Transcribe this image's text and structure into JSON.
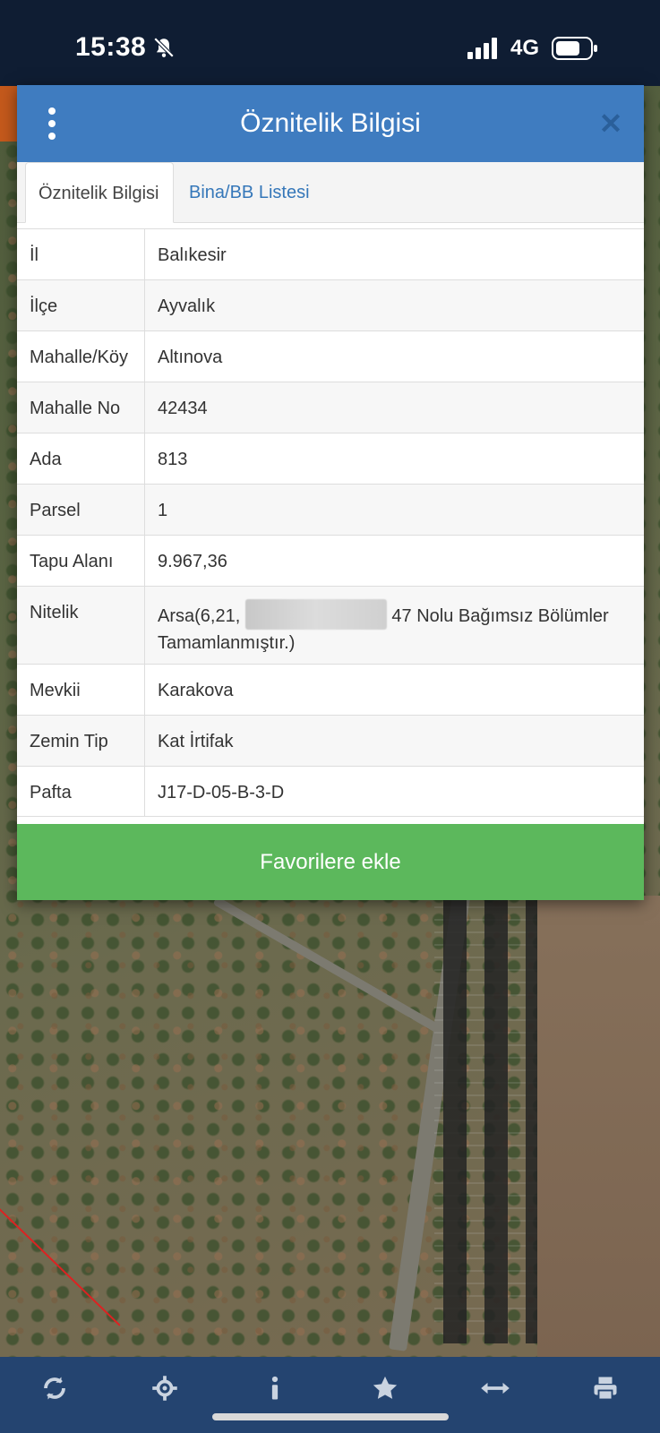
{
  "status_bar": {
    "time": "15:38",
    "network": "4G",
    "icons": [
      "bell-muted-icon",
      "signal-icon",
      "battery-icon"
    ]
  },
  "modal": {
    "title": "Öznitelik Bilgisi",
    "menu_icon": "more-vertical-icon",
    "close_icon": "close-icon",
    "close_glyph": "✕",
    "tabs": [
      {
        "label": "Öznitelik Bilgisi",
        "active": true
      },
      {
        "label": "Bina/BB Listesi",
        "active": false
      }
    ],
    "rows": [
      {
        "key": "İl",
        "value": "Balıkesir"
      },
      {
        "key": "İlçe",
        "value": "Ayvalık"
      },
      {
        "key": "Mahalle/Köy",
        "value": "Altınova"
      },
      {
        "key": "Mahalle No",
        "value": "42434"
      },
      {
        "key": "Ada",
        "value": "813"
      },
      {
        "key": "Parsel",
        "value": "1"
      },
      {
        "key": "Tapu Alanı",
        "value": "9.967,36"
      },
      {
        "key": "Nitelik",
        "value_prefix": "Arsa(6,21,",
        "value_suffix": "47 Nolu Bağımsız Bölümler Tamamlanmıştır.)"
      },
      {
        "key": "Mevkii",
        "value": "Karakova"
      },
      {
        "key": "Zemin Tip",
        "value": "Kat İrtifak"
      },
      {
        "key": "Pafta",
        "value": "J17-D-05-B-3-D"
      }
    ],
    "favorite_button": "Favorilere ekle"
  },
  "toolbar": {
    "items": [
      "refresh-icon",
      "locate-icon",
      "info-icon",
      "star-icon",
      "measure-icon",
      "print-icon"
    ]
  },
  "colors": {
    "header_blue": "#3f7cc0",
    "toolbar_blue": "#244470",
    "button_green": "#5cb85c",
    "status_bar": "#0f1d33"
  }
}
